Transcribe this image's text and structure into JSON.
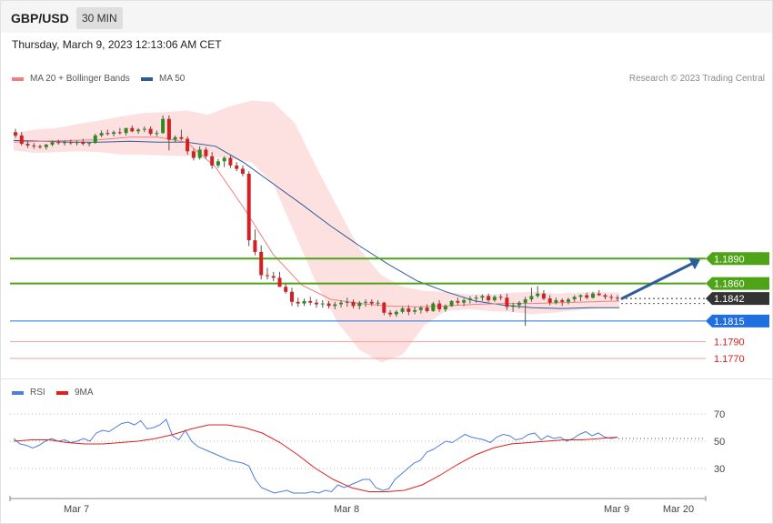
{
  "header": {
    "symbol": "GBP/USD",
    "timeframe": "30 MIN",
    "timestamp": "Thursday, March 9, 2023 12:13:06 AM CET"
  },
  "legend": {
    "ma20_label": "MA 20 + Bollinger Bands",
    "ma20_color": "#f08080",
    "ma50_label": "MA 50",
    "ma50_color": "#2e5c99",
    "credit": "Research © 2023 Trading Central"
  },
  "rsi_legend": {
    "rsi_label": "RSI",
    "rsi_color": "#4f7dd9",
    "ma_label": "9MA",
    "ma_color": "#e02020"
  },
  "chart_data": [
    {
      "type": "candlestick",
      "title": "GBP/USD",
      "y_range": [
        1.1747,
        1.2097
      ],
      "x_labels": [
        "Mar 7",
        "Mar 8",
        "Mar 9",
        "Mar 20"
      ],
      "colors": {
        "up": "#2e8b1e",
        "down": "#d42020",
        "bollinger_fill": "#fde0e0",
        "ma20": "#f08080",
        "ma50": "#2e5c99"
      },
      "candles_ohlc": [
        [
          1.2042,
          1.2046,
          1.2035,
          1.2038
        ],
        [
          1.2038,
          1.2042,
          1.2026,
          1.2028
        ],
        [
          1.2028,
          1.2031,
          1.2023,
          1.2026
        ],
        [
          1.2026,
          1.2029,
          1.2022,
          1.2025
        ],
        [
          1.2025,
          1.2027,
          1.2022,
          1.2024
        ],
        [
          1.2024,
          1.2028,
          1.2021,
          1.2027
        ],
        [
          1.2027,
          1.2032,
          1.2025,
          1.203
        ],
        [
          1.203,
          1.2033,
          1.2027,
          1.2029
        ],
        [
          1.2029,
          1.2032,
          1.2026,
          1.203
        ],
        [
          1.203,
          1.2033,
          1.2027,
          1.2029
        ],
        [
          1.2029,
          1.2032,
          1.2026,
          1.203
        ],
        [
          1.203,
          1.2034,
          1.2026,
          1.2028
        ],
        [
          1.2028,
          1.203,
          1.2025,
          1.2029
        ],
        [
          1.2029,
          1.204,
          1.2028,
          1.2038
        ],
        [
          1.2038,
          1.2044,
          1.2036,
          1.2041
        ],
        [
          1.2041,
          1.2045,
          1.2038,
          1.204
        ],
        [
          1.204,
          1.2044,
          1.2037,
          1.2042
        ],
        [
          1.2042,
          1.2047,
          1.2039,
          1.2041
        ],
        [
          1.2041,
          1.2046,
          1.2038,
          1.2047
        ],
        [
          1.2047,
          1.205,
          1.2042,
          1.2043
        ],
        [
          1.2043,
          1.2047,
          1.204,
          1.2045
        ],
        [
          1.2045,
          1.2049,
          1.2042,
          1.2046
        ],
        [
          1.2046,
          1.2049,
          1.2038,
          1.204
        ],
        [
          1.204,
          1.2044,
          1.2037,
          1.2041
        ],
        [
          1.2041,
          1.2062,
          1.204,
          1.2058
        ],
        [
          1.2058,
          1.2062,
          1.202,
          1.2033
        ],
        [
          1.2033,
          1.2038,
          1.203,
          1.2036
        ],
        [
          1.2036,
          1.2045,
          1.2032,
          1.2034
        ],
        [
          1.2034,
          1.2037,
          1.2015,
          1.2019
        ],
        [
          1.2019,
          1.2022,
          1.2008,
          1.2011
        ],
        [
          1.2011,
          1.2025,
          1.2009,
          1.2021
        ],
        [
          1.2021,
          1.2024,
          1.201,
          1.2013
        ],
        [
          1.2013,
          1.2018,
          1.1998,
          1.2002
        ],
        [
          1.2002,
          1.201,
          1.1999,
          1.2007
        ],
        [
          1.2007,
          1.2013,
          1.2,
          1.2011
        ],
        [
          1.2011,
          1.2014,
          1.1999,
          1.2002
        ],
        [
          1.2002,
          1.2006,
          1.1995,
          1.1998
        ],
        [
          1.1998,
          1.2002,
          1.1989,
          1.1992
        ],
        [
          1.1992,
          1.1995,
          1.1905,
          1.1912
        ],
        [
          1.1912,
          1.1925,
          1.1894,
          1.1898
        ],
        [
          1.1898,
          1.1906,
          1.1865,
          1.187
        ],
        [
          1.187,
          1.1879,
          1.1865,
          1.1869
        ],
        [
          1.1869,
          1.1874,
          1.1863,
          1.1867
        ],
        [
          1.1867,
          1.1874,
          1.186,
          1.1856
        ],
        [
          1.1856,
          1.186,
          1.1848,
          1.185
        ],
        [
          1.185,
          1.1855,
          1.1833,
          1.1838
        ],
        [
          1.1838,
          1.1843,
          1.1832,
          1.1836
        ],
        [
          1.1836,
          1.1842,
          1.1833,
          1.1839
        ],
        [
          1.1839,
          1.1844,
          1.1834,
          1.1837
        ],
        [
          1.1837,
          1.1841,
          1.1831,
          1.1835
        ],
        [
          1.1835,
          1.184,
          1.1831,
          1.1836
        ],
        [
          1.1836,
          1.1839,
          1.183,
          1.1833
        ],
        [
          1.1833,
          1.1838,
          1.1829,
          1.1835
        ],
        [
          1.1835,
          1.184,
          1.1831,
          1.1837
        ],
        [
          1.1837,
          1.1843,
          1.1832,
          1.1838
        ],
        [
          1.1838,
          1.1841,
          1.183,
          1.1833
        ],
        [
          1.1833,
          1.1839,
          1.1829,
          1.1837
        ],
        [
          1.1837,
          1.1841,
          1.1832,
          1.1838
        ],
        [
          1.1838,
          1.1841,
          1.1833,
          1.1836
        ],
        [
          1.1836,
          1.184,
          1.1833,
          1.1837
        ],
        [
          1.1837,
          1.1838,
          1.1822,
          1.1825
        ],
        [
          1.1825,
          1.1828,
          1.182,
          1.1823
        ],
        [
          1.1823,
          1.1828,
          1.182,
          1.1826
        ],
        [
          1.1826,
          1.1832,
          1.1824,
          1.183
        ],
        [
          1.183,
          1.1834,
          1.1822,
          1.1826
        ],
        [
          1.1826,
          1.1832,
          1.1823,
          1.1828
        ],
        [
          1.1828,
          1.1833,
          1.1824,
          1.1831
        ],
        [
          1.1831,
          1.1835,
          1.1825,
          1.1827
        ],
        [
          1.1827,
          1.1838,
          1.1826,
          1.1836
        ],
        [
          1.1836,
          1.184,
          1.1826,
          1.1829
        ],
        [
          1.1829,
          1.1835,
          1.1826,
          1.1833
        ],
        [
          1.1833,
          1.184,
          1.1832,
          1.1839
        ],
        [
          1.1839,
          1.1843,
          1.1834,
          1.1837
        ],
        [
          1.1837,
          1.1842,
          1.1833,
          1.184
        ],
        [
          1.184,
          1.1845,
          1.1836,
          1.1842
        ],
        [
          1.1842,
          1.1846,
          1.1837,
          1.1843
        ],
        [
          1.1843,
          1.1847,
          1.1839,
          1.1845
        ],
        [
          1.1845,
          1.1848,
          1.1838,
          1.184
        ],
        [
          1.184,
          1.1846,
          1.1838,
          1.1844
        ],
        [
          1.1844,
          1.1847,
          1.184,
          1.1843
        ],
        [
          1.1843,
          1.1848,
          1.1828,
          1.1832
        ],
        [
          1.1832,
          1.1837,
          1.1826,
          1.1834
        ],
        [
          1.1834,
          1.1839,
          1.183,
          1.1837
        ],
        [
          1.1837,
          1.1844,
          1.1809,
          1.1841
        ],
        [
          1.1841,
          1.1855,
          1.1838,
          1.1845
        ],
        [
          1.1845,
          1.1857,
          1.1843,
          1.1848
        ],
        [
          1.1848,
          1.1852,
          1.184,
          1.1842
        ],
        [
          1.1842,
          1.1846,
          1.1834,
          1.1837
        ],
        [
          1.1837,
          1.1843,
          1.1835,
          1.184
        ],
        [
          1.184,
          1.1842,
          1.1833,
          1.1838
        ],
        [
          1.1838,
          1.1843,
          1.1835,
          1.1841
        ],
        [
          1.1841,
          1.1846,
          1.1838,
          1.1844
        ],
        [
          1.1844,
          1.1847,
          1.1839,
          1.1846
        ],
        [
          1.1846,
          1.1849,
          1.1841,
          1.1843
        ],
        [
          1.1843,
          1.185,
          1.1842,
          1.1848
        ],
        [
          1.1848,
          1.1852,
          1.1845,
          1.1846
        ],
        [
          1.1846,
          1.1848,
          1.1841,
          1.1844
        ],
        [
          1.1844,
          1.1847,
          1.184,
          1.1843
        ],
        [
          1.1843,
          1.1846,
          1.1839,
          1.1842
        ]
      ],
      "ma20": [
        1.203,
        1.2031,
        1.2032,
        1.2033,
        1.2036,
        1.2036,
        1.203,
        1.2,
        1.195,
        1.1895,
        1.1858,
        1.1841,
        1.1836,
        1.1833,
        1.1832,
        1.1833,
        1.1835,
        1.1836,
        1.1836,
        1.1837,
        1.1838,
        1.1839
      ],
      "ma50": [
        1.2032,
        1.2031,
        1.203,
        1.203,
        1.2031,
        1.203,
        1.203,
        1.2025,
        1.2005,
        1.198,
        1.1955,
        1.1929,
        1.1905,
        1.1883,
        1.1863,
        1.185,
        1.1839,
        1.1834,
        1.1831,
        1.183,
        1.1831,
        1.1831
      ],
      "bollinger_upper": [
        1.2041,
        1.2045,
        1.2047,
        1.2052,
        1.2056,
        1.2061,
        1.2065,
        1.2066,
        1.2068,
        1.2063,
        1.2073,
        1.208,
        1.2078,
        1.2053,
        1.2,
        1.195,
        1.1901,
        1.187,
        1.1856,
        1.1851,
        1.185,
        1.1847,
        1.1847,
        1.1849,
        1.185,
        1.1848,
        1.1849,
        1.185,
        1.1849
      ],
      "bollinger_lower": [
        1.202,
        1.2017,
        1.2018,
        1.2019,
        1.2018,
        1.2015,
        1.2015,
        1.2014,
        1.2013,
        1.2013,
        1.201,
        1.2006,
        1.198,
        1.192,
        1.186,
        1.1812,
        1.178,
        1.1765,
        1.1775,
        1.181,
        1.1827,
        1.1829,
        1.1827,
        1.1826,
        1.1823,
        1.1825,
        1.1828,
        1.183,
        1.1831
      ],
      "forecast_arrow": {
        "from": 1.1842,
        "to": 1.189,
        "color": "#2e5c99"
      },
      "levels": [
        {
          "label": "1.1890",
          "value": 1.189,
          "style": "resistance",
          "color": "#4fa317"
        },
        {
          "label": "1.1860",
          "value": 1.186,
          "style": "resistance",
          "color": "#4fa317"
        },
        {
          "label": "1.1842",
          "value": 1.1842,
          "style": "last",
          "color": "#333333"
        },
        {
          "label": "1.1815",
          "value": 1.1815,
          "style": "pivot",
          "color": "#1f6fe0"
        },
        {
          "label": "1.1790",
          "value": 1.179,
          "style": "support",
          "color": "#d42020"
        },
        {
          "label": "1.1770",
          "value": 1.177,
          "style": "support",
          "color": "#d42020"
        }
      ]
    },
    {
      "type": "line",
      "title": "RSI",
      "y_range": [
        10,
        80
      ],
      "y_ticks": [
        70,
        50,
        30
      ],
      "series": [
        {
          "name": "RSI",
          "color": "#4f7dd9",
          "values": [
            52,
            48,
            47,
            45,
            47,
            50,
            52,
            50,
            51,
            49,
            50,
            52,
            50,
            56,
            58,
            57,
            60,
            63,
            64,
            62,
            65,
            59,
            60,
            62,
            66,
            54,
            51,
            58,
            50,
            46,
            44,
            42,
            40,
            38,
            36,
            35,
            34,
            32,
            22,
            16,
            14,
            12,
            13,
            14,
            12,
            12,
            12,
            13,
            12,
            14,
            13,
            18,
            16,
            18,
            20,
            22,
            22,
            16,
            14,
            15,
            22,
            26,
            30,
            34,
            36,
            42,
            44,
            47,
            50,
            49,
            52,
            55,
            53,
            52,
            51,
            49,
            53,
            55,
            54,
            51,
            52,
            55,
            56,
            51,
            54,
            52,
            53,
            50,
            52,
            55,
            57,
            54,
            56,
            53,
            52,
            53
          ]
        },
        {
          "name": "9MA",
          "color": "#e02020",
          "values": [
            50,
            51,
            51,
            49,
            48,
            48,
            49,
            50,
            52,
            55,
            59,
            62,
            62,
            60,
            56,
            49,
            40,
            30,
            22,
            16,
            13,
            13,
            14,
            18,
            25,
            33,
            40,
            45,
            48,
            49,
            50,
            51,
            51,
            52,
            53
          ]
        }
      ]
    }
  ]
}
